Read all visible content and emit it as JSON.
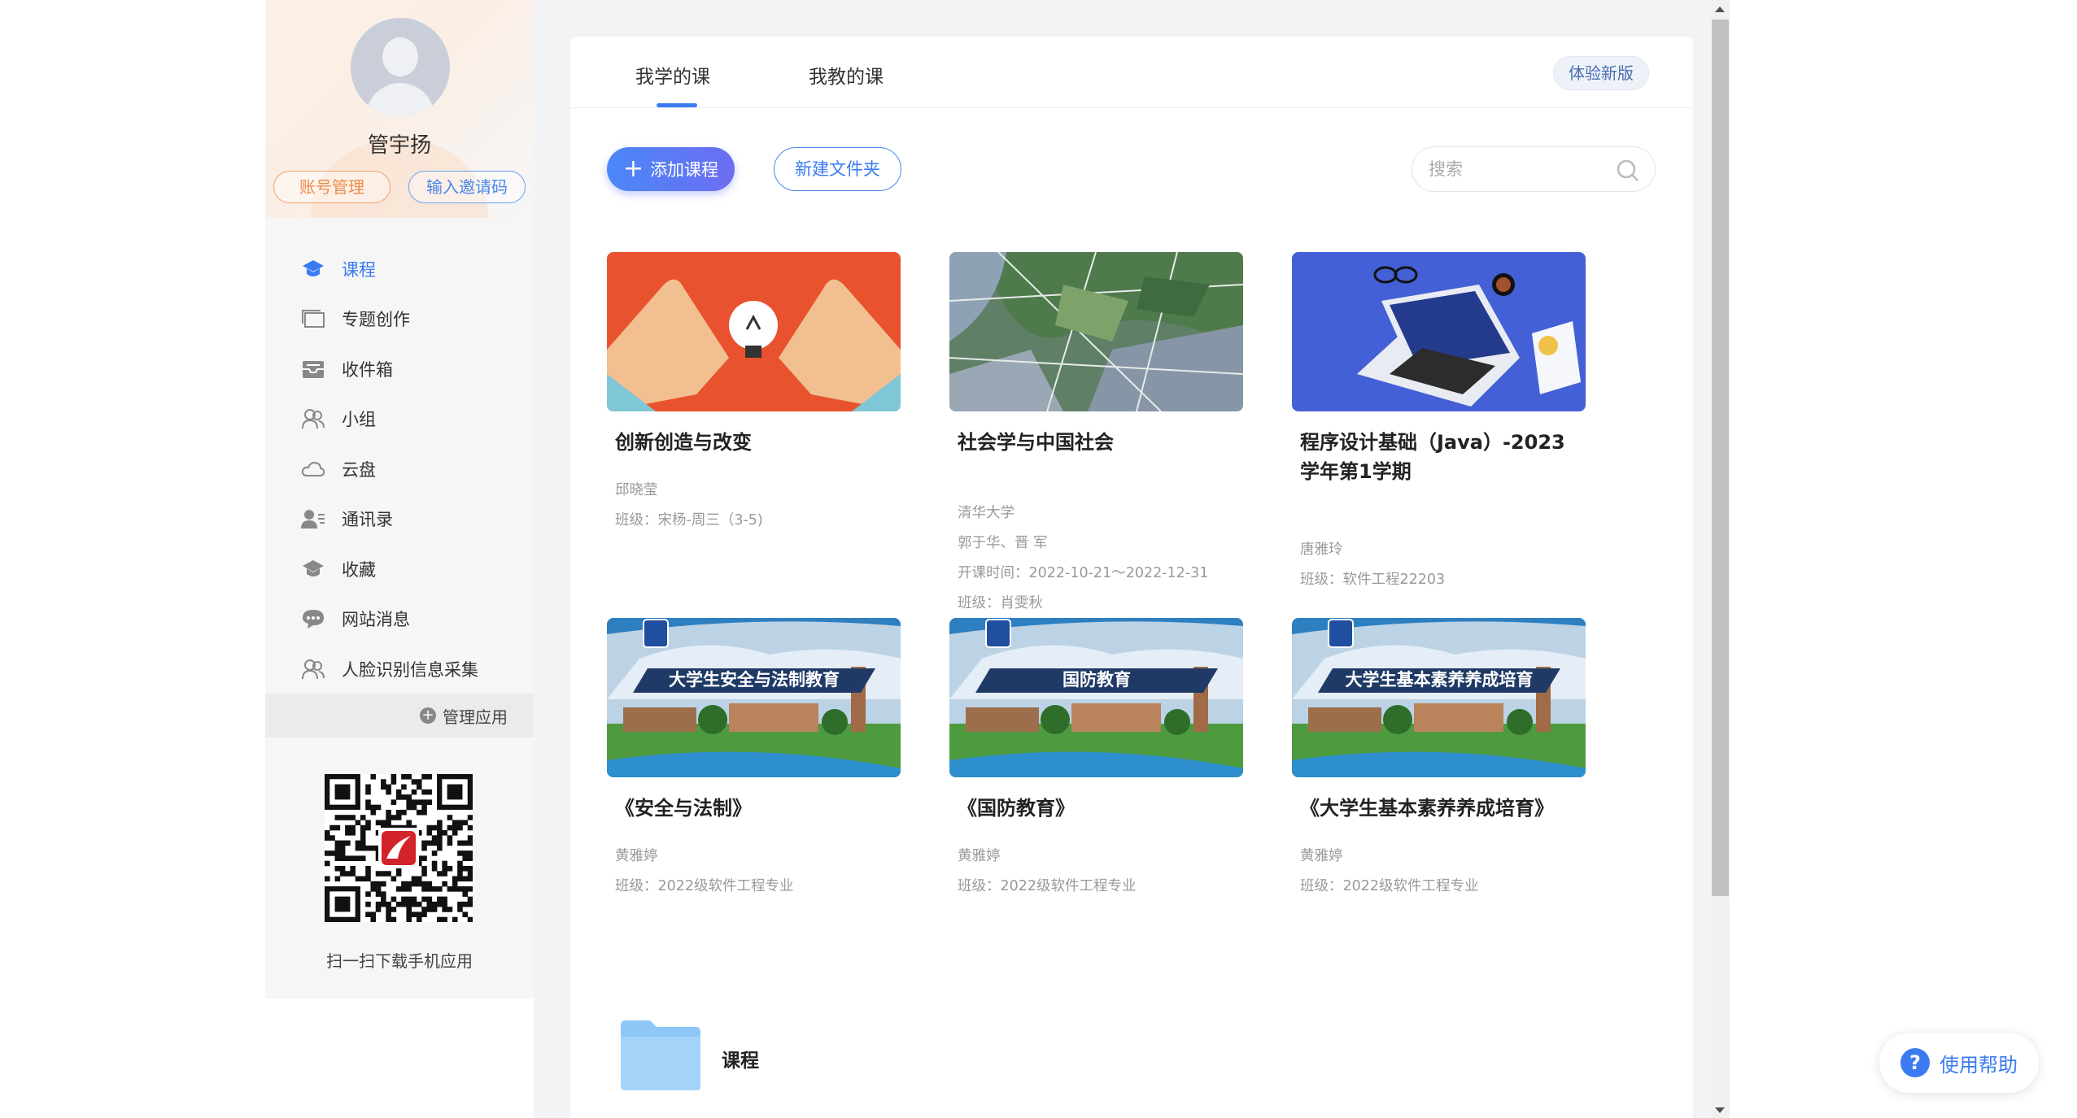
{
  "profile": {
    "username": "管宇扬",
    "account_button": "账号管理",
    "invite_button": "输入邀请码"
  },
  "nav": {
    "items": [
      {
        "label": "课程",
        "icon": "graduation-cap-icon",
        "active": true
      },
      {
        "label": "专题创作",
        "icon": "layers-icon"
      },
      {
        "label": "收件箱",
        "icon": "inbox-icon"
      },
      {
        "label": "小组",
        "icon": "group-icon"
      },
      {
        "label": "云盘",
        "icon": "cloud-icon"
      },
      {
        "label": "通讯录",
        "icon": "contacts-icon"
      },
      {
        "label": "收藏",
        "icon": "favorite-icon"
      },
      {
        "label": "网站消息",
        "icon": "message-icon"
      },
      {
        "label": "人脸识别信息采集",
        "icon": "face-id-icon"
      }
    ],
    "manage_apps": "管理应用"
  },
  "qr": {
    "caption": "扫一扫下载手机应用"
  },
  "tabs": {
    "learning": "我学的课",
    "teaching": "我教的课",
    "try_new": "体验新版"
  },
  "toolbar": {
    "add_course": "添加课程",
    "new_folder": "新建文件夹",
    "search_placeholder": "搜索"
  },
  "courses": [
    {
      "title": "创新创造与改变",
      "lines": [
        "邱晓莹",
        "班级：宋杨-周三（3-5)"
      ]
    },
    {
      "title": "社会学与中国社会",
      "lines": [
        "清华大学",
        "郭于华、晋 军",
        "开课时间：2022-10-21～2022-12-31",
        "班级：肖雯秋"
      ]
    },
    {
      "title": "程序设计基础（Java）-2023学年第1学期",
      "lines": [
        "唐雅玲",
        "班级：软件工程22203"
      ]
    },
    {
      "title": "《安全与法制》",
      "banner": "大学生安全与法制教育",
      "lines": [
        "黄雅婷",
        "班级：2022级软件工程专业"
      ]
    },
    {
      "title": "《国防教育》",
      "banner": "国防教育",
      "lines": [
        "黄雅婷",
        "班级：2022级软件工程专业"
      ]
    },
    {
      "title": "《大学生基本素养养成培育》",
      "banner": "大学生基本素养养成培育",
      "lines": [
        "黄雅婷",
        "班级：2022级软件工程专业"
      ]
    }
  ],
  "folder": {
    "label": "课程"
  },
  "help": {
    "label": "使用帮助"
  },
  "colors": {
    "accent": "#3b7bf1",
    "orange": "#f08a4b"
  }
}
